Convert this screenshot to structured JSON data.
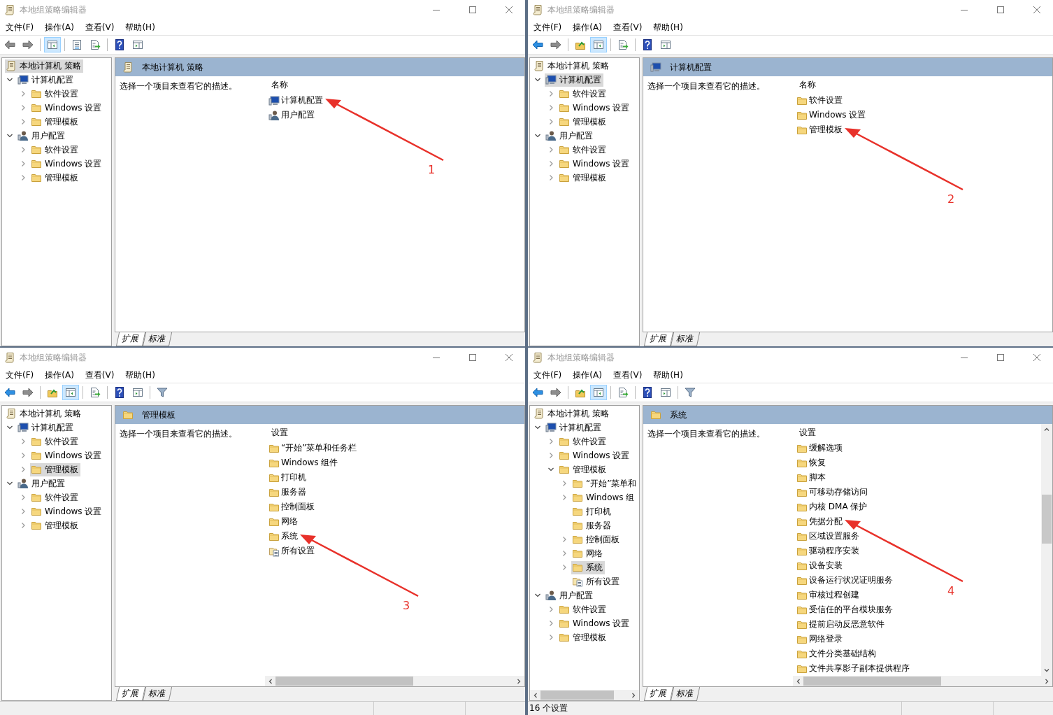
{
  "windows": [
    {
      "title": "本地组策略编辑器",
      "menu": [
        "文件(F)",
        "操作(A)",
        "查看(V)",
        "帮助(H)"
      ],
      "toolbar_groups": [
        {
          "buttons": [
            {
              "kind": "back",
              "disabled": true,
              "pressed": false
            },
            {
              "kind": "forward",
              "disabled": true,
              "pressed": false
            }
          ]
        },
        {
          "buttons": [
            {
              "kind": "tree-toggle",
              "disabled": false,
              "pressed": true
            }
          ]
        },
        {
          "buttons": [
            {
              "kind": "properties",
              "disabled": false,
              "pressed": false
            },
            {
              "kind": "export",
              "disabled": false,
              "pressed": false
            }
          ]
        },
        {
          "buttons": [
            {
              "kind": "help",
              "disabled": false,
              "pressed": false
            },
            {
              "kind": "action-pane",
              "disabled": false,
              "pressed": false
            }
          ]
        }
      ],
      "tree": [
        {
          "label": "本地计算机 策略",
          "kind": "policy",
          "selected": true,
          "children": [
            {
              "label": "计算机配置",
              "kind": "computer",
              "selected": false,
              "expanded": true,
              "children": [
                {
                  "label": "软件设置",
                  "kind": "folder",
                  "selected": false,
                  "expanded": false
                },
                {
                  "label": "Windows 设置",
                  "kind": "folder",
                  "selected": false,
                  "expanded": false
                },
                {
                  "label": "管理模板",
                  "kind": "folder",
                  "selected": false,
                  "expanded": false
                }
              ]
            },
            {
              "label": "用户配置",
              "kind": "user",
              "selected": false,
              "expanded": true,
              "children": [
                {
                  "label": "软件设置",
                  "kind": "folder",
                  "selected": false,
                  "expanded": false
                },
                {
                  "label": "Windows 设置",
                  "kind": "folder",
                  "selected": false,
                  "expanded": false
                },
                {
                  "label": "管理模板",
                  "kind": "folder",
                  "selected": false,
                  "expanded": false
                }
              ]
            }
          ]
        }
      ],
      "header": {
        "kind": "policy",
        "title": "本地计算机 策略"
      },
      "description": "选择一个项目来查看它的描述。",
      "column": "名称",
      "items": [
        {
          "label": "计算机配置",
          "kind": "computer",
          "callout": "1"
        },
        {
          "label": "用户配置",
          "kind": "user"
        }
      ],
      "tabs": [
        {
          "label": "扩展",
          "selected": true
        },
        {
          "label": "标准",
          "selected": false
        }
      ]
    },
    {
      "title": "本地组策略编辑器",
      "menu": [
        "文件(F)",
        "操作(A)",
        "查看(V)",
        "帮助(H)"
      ],
      "toolbar_groups": [
        {
          "buttons": [
            {
              "kind": "back",
              "disabled": false,
              "pressed": false
            },
            {
              "kind": "forward",
              "disabled": true,
              "pressed": false
            }
          ]
        },
        {
          "buttons": [
            {
              "kind": "up",
              "disabled": false,
              "pressed": false
            },
            {
              "kind": "tree-toggle",
              "disabled": false,
              "pressed": true
            }
          ]
        },
        {
          "buttons": [
            {
              "kind": "export",
              "disabled": false,
              "pressed": false
            }
          ]
        },
        {
          "buttons": [
            {
              "kind": "help",
              "disabled": false,
              "pressed": false
            },
            {
              "kind": "action-pane",
              "disabled": false,
              "pressed": false
            }
          ]
        }
      ],
      "tree": [
        {
          "label": "本地计算机 策略",
          "kind": "policy",
          "selected": false,
          "children": [
            {
              "label": "计算机配置",
              "kind": "computer",
              "selected": true,
              "expanded": true,
              "children": [
                {
                  "label": "软件设置",
                  "kind": "folder",
                  "selected": false,
                  "expanded": false
                },
                {
                  "label": "Windows 设置",
                  "kind": "folder",
                  "selected": false,
                  "expanded": false
                },
                {
                  "label": "管理模板",
                  "kind": "folder",
                  "selected": false,
                  "expanded": false
                }
              ]
            },
            {
              "label": "用户配置",
              "kind": "user",
              "selected": false,
              "expanded": true,
              "children": [
                {
                  "label": "软件设置",
                  "kind": "folder",
                  "selected": false,
                  "expanded": false
                },
                {
                  "label": "Windows 设置",
                  "kind": "folder",
                  "selected": false,
                  "expanded": false
                },
                {
                  "label": "管理模板",
                  "kind": "folder",
                  "selected": false,
                  "expanded": false
                }
              ]
            }
          ]
        }
      ],
      "header": {
        "kind": "computer",
        "title": "计算机配置"
      },
      "description": "选择一个项目来查看它的描述。",
      "column": "名称",
      "items": [
        {
          "label": "软件设置",
          "kind": "folder"
        },
        {
          "label": "Windows 设置",
          "kind": "folder"
        },
        {
          "label": "管理模板",
          "kind": "folder",
          "callout": "2"
        }
      ],
      "tabs": [
        {
          "label": "扩展",
          "selected": true
        },
        {
          "label": "标准",
          "selected": false
        }
      ]
    },
    {
      "title": "本地组策略编辑器",
      "menu": [
        "文件(F)",
        "操作(A)",
        "查看(V)",
        "帮助(H)"
      ],
      "toolbar_groups": [
        {
          "buttons": [
            {
              "kind": "back",
              "disabled": false,
              "pressed": false
            },
            {
              "kind": "forward",
              "disabled": true,
              "pressed": false
            }
          ]
        },
        {
          "buttons": [
            {
              "kind": "up",
              "disabled": false,
              "pressed": false
            },
            {
              "kind": "tree-toggle",
              "disabled": false,
              "pressed": true
            }
          ]
        },
        {
          "buttons": [
            {
              "kind": "export",
              "disabled": false,
              "pressed": false
            }
          ]
        },
        {
          "buttons": [
            {
              "kind": "help",
              "disabled": false,
              "pressed": false
            },
            {
              "kind": "action-pane",
              "disabled": false,
              "pressed": false
            }
          ]
        },
        {
          "buttons": [
            {
              "kind": "filter",
              "disabled": false,
              "pressed": false
            }
          ]
        }
      ],
      "tree": [
        {
          "label": "本地计算机 策略",
          "kind": "policy",
          "selected": false,
          "children": [
            {
              "label": "计算机配置",
              "kind": "computer",
              "selected": false,
              "expanded": true,
              "children": [
                {
                  "label": "软件设置",
                  "kind": "folder",
                  "selected": false,
                  "expanded": false
                },
                {
                  "label": "Windows 设置",
                  "kind": "folder",
                  "selected": false,
                  "expanded": false
                },
                {
                  "label": "管理模板",
                  "kind": "folder",
                  "selected": true,
                  "expanded": false
                }
              ]
            },
            {
              "label": "用户配置",
              "kind": "user",
              "selected": false,
              "expanded": true,
              "children": [
                {
                  "label": "软件设置",
                  "kind": "folder",
                  "selected": false,
                  "expanded": false
                },
                {
                  "label": "Windows 设置",
                  "kind": "folder",
                  "selected": false,
                  "expanded": false
                },
                {
                  "label": "管理模板",
                  "kind": "folder",
                  "selected": false,
                  "expanded": false
                }
              ]
            }
          ]
        }
      ],
      "header": {
        "kind": "folder",
        "title": "管理模板"
      },
      "description": "选择一个项目来查看它的描述。",
      "column": "设置",
      "items": [
        {
          "label": "“开始”菜单和任务栏",
          "kind": "folder"
        },
        {
          "label": "Windows 组件",
          "kind": "folder"
        },
        {
          "label": "打印机",
          "kind": "folder"
        },
        {
          "label": "服务器",
          "kind": "folder"
        },
        {
          "label": "控制面板",
          "kind": "folder"
        },
        {
          "label": "网络",
          "kind": "folder"
        },
        {
          "label": "系统",
          "kind": "folder",
          "callout": "3"
        },
        {
          "label": "所有设置",
          "kind": "all-settings"
        }
      ],
      "list_h_scrollbar": true,
      "status_bar": true,
      "tabs": [
        {
          "label": "扩展",
          "selected": true
        },
        {
          "label": "标准",
          "selected": false
        }
      ]
    },
    {
      "title": "本地组策略编辑器",
      "menu": [
        "文件(F)",
        "操作(A)",
        "查看(V)",
        "帮助(H)"
      ],
      "toolbar_groups": [
        {
          "buttons": [
            {
              "kind": "back",
              "disabled": false,
              "pressed": false
            },
            {
              "kind": "forward",
              "disabled": true,
              "pressed": false
            }
          ]
        },
        {
          "buttons": [
            {
              "kind": "up",
              "disabled": false,
              "pressed": false
            },
            {
              "kind": "tree-toggle",
              "disabled": false,
              "pressed": true
            }
          ]
        },
        {
          "buttons": [
            {
              "kind": "export",
              "disabled": false,
              "pressed": false
            }
          ]
        },
        {
          "buttons": [
            {
              "kind": "help",
              "disabled": false,
              "pressed": false
            },
            {
              "kind": "action-pane",
              "disabled": false,
              "pressed": false
            }
          ]
        },
        {
          "buttons": [
            {
              "kind": "filter",
              "disabled": false,
              "pressed": false
            }
          ]
        }
      ],
      "tree": [
        {
          "label": "本地计算机 策略",
          "kind": "policy",
          "selected": false,
          "children": [
            {
              "label": "计算机配置",
              "kind": "computer",
              "selected": false,
              "expanded": true,
              "children": [
                {
                  "label": "软件设置",
                  "kind": "folder",
                  "selected": false,
                  "expanded": false
                },
                {
                  "label": "Windows 设置",
                  "kind": "folder",
                  "selected": false,
                  "expanded": false
                },
                {
                  "label": "管理模板",
                  "kind": "folder",
                  "selected": false,
                  "expanded": true,
                  "children": [
                    {
                      "label": "“开始”菜单和",
                      "kind": "folder",
                      "selected": false,
                      "expanded": false
                    },
                    {
                      "label": "Windows 组",
                      "kind": "folder",
                      "selected": false,
                      "expanded": false
                    },
                    {
                      "label": "打印机",
                      "kind": "folder",
                      "selected": false
                    },
                    {
                      "label": "服务器",
                      "kind": "folder",
                      "selected": false
                    },
                    {
                      "label": "控制面板",
                      "kind": "folder",
                      "selected": false,
                      "expanded": false
                    },
                    {
                      "label": "网络",
                      "kind": "folder",
                      "selected": false,
                      "expanded": false
                    },
                    {
                      "label": "系统",
                      "kind": "folder",
                      "selected": true,
                      "expanded": false
                    },
                    {
                      "label": "所有设置",
                      "kind": "all-settings",
                      "selected": false
                    }
                  ]
                }
              ]
            },
            {
              "label": "用户配置",
              "kind": "user",
              "selected": false,
              "expanded": true,
              "children": [
                {
                  "label": "软件设置",
                  "kind": "folder",
                  "selected": false,
                  "expanded": false
                },
                {
                  "label": "Windows 设置",
                  "kind": "folder",
                  "selected": false,
                  "expanded": false
                },
                {
                  "label": "管理模板",
                  "kind": "folder",
                  "selected": false,
                  "expanded": false
                }
              ]
            }
          ]
        }
      ],
      "tree_h_scrollbar": true,
      "header": {
        "kind": "folder",
        "title": "系统"
      },
      "description": "选择一个项目来查看它的描述。",
      "column": "设置",
      "items": [
        {
          "label": "缓解选项",
          "kind": "folder"
        },
        {
          "label": "恢复",
          "kind": "folder"
        },
        {
          "label": "脚本",
          "kind": "folder"
        },
        {
          "label": "可移动存储访问",
          "kind": "folder"
        },
        {
          "label": "内核 DMA 保护",
          "kind": "folder"
        },
        {
          "label": "凭据分配",
          "kind": "folder",
          "callout": "4"
        },
        {
          "label": "区域设置服务",
          "kind": "folder"
        },
        {
          "label": "驱动程序安装",
          "kind": "folder"
        },
        {
          "label": "设备安装",
          "kind": "folder"
        },
        {
          "label": "设备运行状况证明服务",
          "kind": "folder"
        },
        {
          "label": "审核过程创建",
          "kind": "folder"
        },
        {
          "label": "受信任的平台模块服务",
          "kind": "folder"
        },
        {
          "label": "提前启动反恶意软件",
          "kind": "folder"
        },
        {
          "label": "网络登录",
          "kind": "folder"
        },
        {
          "label": "文件分类基础结构",
          "kind": "folder"
        },
        {
          "label": "文件共享影子副本提供程序",
          "kind": "folder"
        }
      ],
      "list_h_scrollbar": true,
      "list_v_scrollbar": true,
      "status_bar": true,
      "status": "16 个设置",
      "tabs": [
        {
          "label": "扩展",
          "selected": true
        },
        {
          "label": "标准",
          "selected": false
        }
      ]
    }
  ]
}
